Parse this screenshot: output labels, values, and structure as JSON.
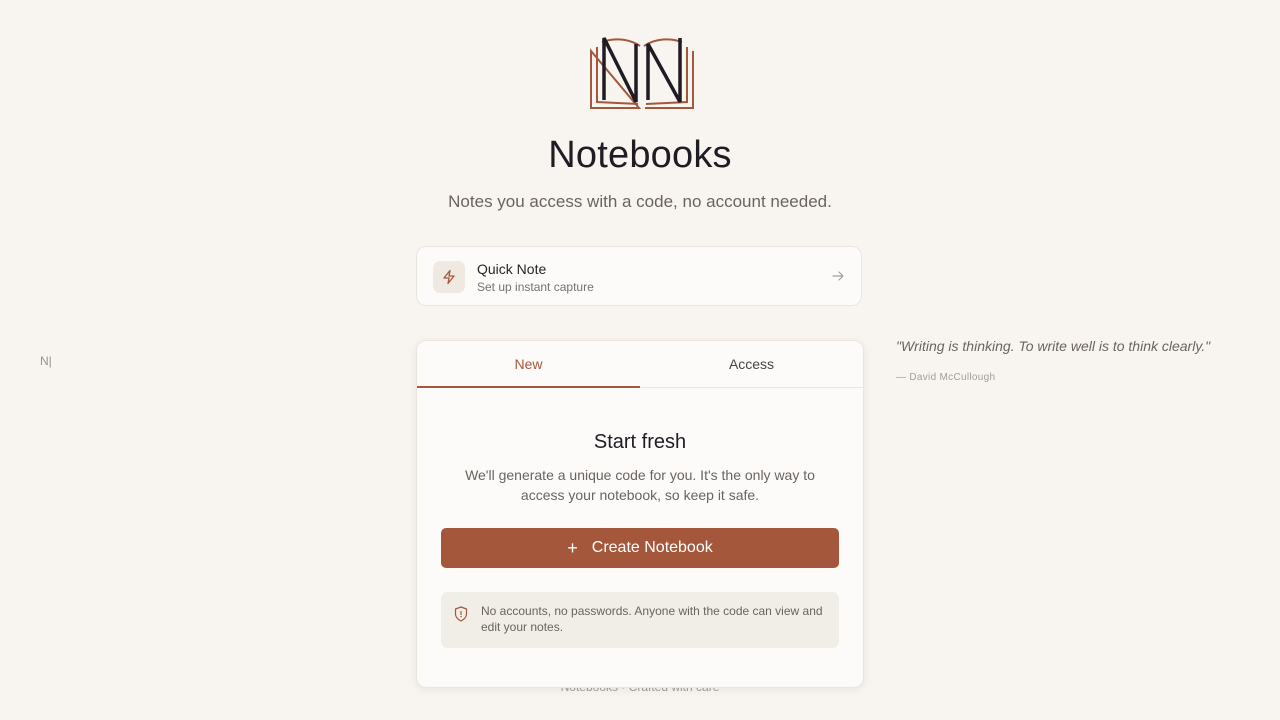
{
  "app": {
    "title": "Notebooks",
    "subtitle": "Notes you access with a code, no account needed.",
    "side_mark": "N|"
  },
  "quick_note": {
    "title": "Quick Note",
    "subtitle": "Set up instant capture",
    "icon": "lightning-icon"
  },
  "tabs": [
    {
      "label": "New",
      "active": true
    },
    {
      "label": "Access",
      "active": false
    }
  ],
  "new_panel": {
    "heading": "Start fresh",
    "description": "We'll generate a unique code for you. It's the only way to access your notebook, so keep it safe.",
    "button_label": "Create Notebook",
    "button_icon": "plus-icon",
    "notice": "No accounts, no passwords. Anyone with the code can view and edit your notes.",
    "notice_icon": "shield-icon"
  },
  "quote": {
    "text": "\"Writing is thinking. To write well is to think clearly.\"",
    "author": "— David McCullough"
  },
  "footer": {
    "text": "Notebooks · Crafted with care"
  },
  "colors": {
    "background": "#f8f5f1",
    "accent": "#a5573c",
    "text": "#2a2522",
    "muted": "#6b635e"
  }
}
